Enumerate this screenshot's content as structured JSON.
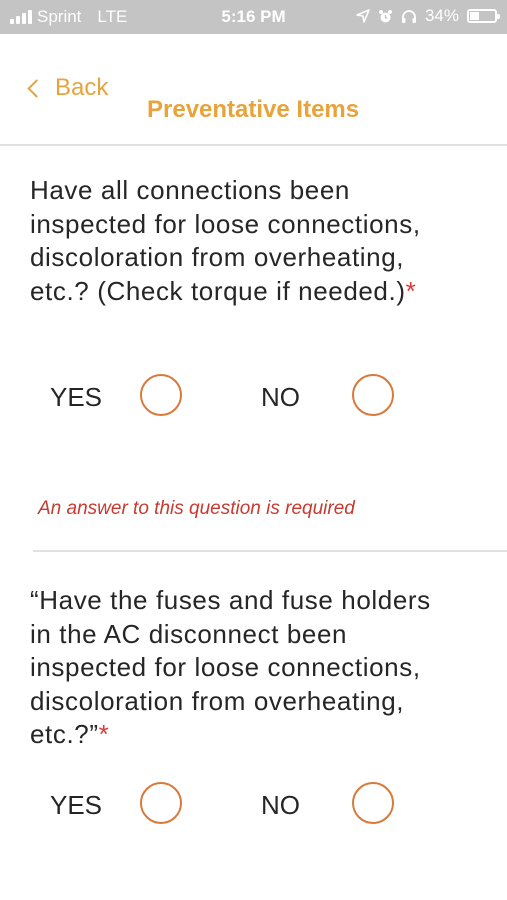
{
  "status_bar": {
    "carrier": "Sprint",
    "network": "LTE",
    "time": "5:16 PM",
    "battery_percent": "34%",
    "battery_level": 0.34,
    "icons": [
      "signal-icon",
      "location-icon",
      "alarm-icon",
      "headphones-icon",
      "battery-icon"
    ]
  },
  "nav": {
    "back_label": "Back",
    "title": "Preventative Items"
  },
  "colors": {
    "accent": "#e8a33b",
    "radio": "#d9793a",
    "error": "#c8392f",
    "required": "#d93b3b"
  },
  "questions": [
    {
      "text": "Have all connections been inspected for loose connections, discoloration from overheating, etc.? (Check torque if needed.)",
      "required_mark": "*",
      "options": [
        {
          "label": "YES",
          "selected": false
        },
        {
          "label": "NO",
          "selected": false
        }
      ],
      "error": "An answer to this question is required"
    },
    {
      "text": "“Have the fuses and fuse holders in the AC disconnect been inspected for loose connections, discoloration from overheating, etc.?”",
      "required_mark": "*",
      "options": [
        {
          "label": "YES",
          "selected": false
        },
        {
          "label": "NO",
          "selected": false
        }
      ]
    }
  ]
}
